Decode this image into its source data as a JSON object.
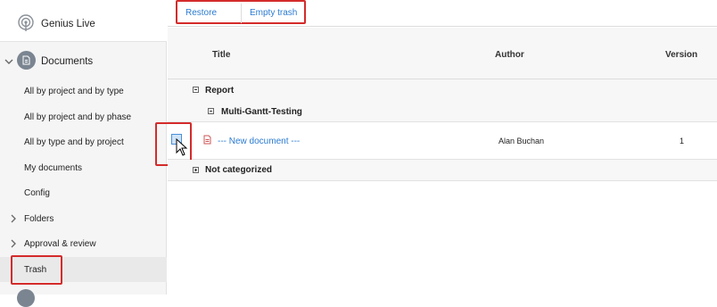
{
  "app": {
    "name": "Genius Live"
  },
  "sidebar": {
    "section_label": "Documents",
    "items": [
      {
        "label": "All by project and by type"
      },
      {
        "label": "All by project and by phase"
      },
      {
        "label": "All by type and by project"
      },
      {
        "label": "My documents"
      },
      {
        "label": "Config"
      },
      {
        "label": "Folders"
      },
      {
        "label": "Approval & review"
      },
      {
        "label": "Trash"
      }
    ]
  },
  "toolbar": {
    "restore_label": "Restore",
    "empty_trash_label": "Empty trash"
  },
  "table": {
    "columns": {
      "title": "Title",
      "author": "Author",
      "version": "Version"
    },
    "groups": [
      {
        "label": "Report"
      },
      {
        "label": "Multi-Gantt-Testing"
      },
      {
        "label": "Not categorized"
      }
    ],
    "document": {
      "title": "--- New document ---",
      "author": "Alan Buchan",
      "version": "1"
    }
  }
}
